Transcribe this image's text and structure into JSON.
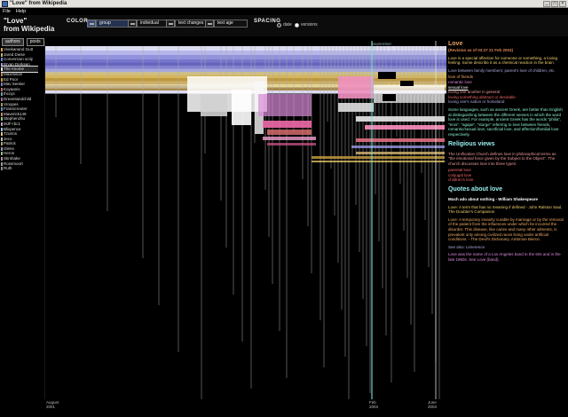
{
  "window": {
    "title": "\"Love\" from Wikipedia"
  },
  "menu": [
    "File",
    "Help"
  ],
  "document": {
    "title": "\"Love\"",
    "subtitle": "from Wikipedia"
  },
  "color": {
    "label": "COLOR",
    "options": [
      {
        "label": "group",
        "selected": true
      },
      {
        "label": "individual",
        "selected": false
      },
      {
        "label": "text changes",
        "selected": false
      },
      {
        "label": "text age",
        "selected": false
      }
    ]
  },
  "spacing": {
    "label": "SPACING",
    "options": [
      {
        "label": "date",
        "selected": true
      },
      {
        "label": "versions",
        "selected": false
      }
    ]
  },
  "tabs": [
    {
      "label": "authors",
      "selected": true
    },
    {
      "label": "posts",
      "selected": false
    }
  ],
  "authors": [
    {
      "name": "Vivekanand Gutta",
      "count": "",
      "color": "#d8a850"
    },
    {
      "name": "Jared Diese",
      "count": "",
      "color": "#c0b070"
    },
    {
      "name": "Conversion script",
      "count": "",
      "color": "#6a8cd0"
    },
    {
      "name": "Bryan Derksen",
      "count": "",
      "color": "#9999cc"
    },
    {
      "name": "The Anome",
      "count": "",
      "color": "#e0e0e0",
      "selected": true
    },
    {
      "name": "Maximilian",
      "count": "",
      "color": "#b08060"
    },
    {
      "name": "Ed Poor",
      "count": "",
      "color": "#d0a030"
    },
    {
      "name": "Mav Seeker",
      "count": "",
      "color": "#8080c0"
    },
    {
      "name": "Koyaanis",
      "count": "",
      "color": "#c07070"
    },
    {
      "name": "Ihcoyc",
      "count": "",
      "color": "#70a0a0"
    },
    {
      "name": "Dreamlandchild",
      "count": "",
      "color": "#a070a0"
    },
    {
      "name": "Vroopes",
      "count": "",
      "color": "#a0a070"
    },
    {
      "name": "Fransicreuter",
      "count": "",
      "color": "#7090c0"
    },
    {
      "name": "Maverick149",
      "count": "",
      "color": "#c09060"
    },
    {
      "name": "Stephenzhu",
      "count": "",
      "color": "#90c090"
    },
    {
      "name": "MJF-rbc1",
      "count": "",
      "color": "#c0a0c0"
    },
    {
      "name": "Blixpence",
      "count": "",
      "color": "#a0c0e0"
    },
    {
      "name": "Tzutros",
      "count": "",
      "color": "#e0c090"
    },
    {
      "name": "Jeco",
      "count": "",
      "color": "#c0c0c0"
    },
    {
      "name": "Patrick",
      "count": "",
      "color": "#b0a080"
    },
    {
      "name": "Glenn",
      "count": "",
      "color": "#90a0b0"
    },
    {
      "name": "Heron",
      "count": "",
      "color": "#a0b090"
    },
    {
      "name": "Skrshake",
      "count": "",
      "color": "#b090a0"
    },
    {
      "name": "Rossmoort",
      "count": "",
      "color": "#a0a0a0"
    },
    {
      "name": "Ruth",
      "count": "",
      "color": "#8090a0"
    }
  ],
  "viz": {
    "revision_label": "September"
  },
  "timeline": [
    {
      "label": "August",
      "sub": "2001"
    },
    {
      "label": "Feb",
      "sub": "2003"
    },
    {
      "label": "June",
      "sub": "2003"
    }
  ],
  "article": {
    "heading": "Love",
    "revision": "(Revision as of 03:27 21 Feb 2003)",
    "p1": "Love is a special affection for someone or something, a loving feeling. Some describe it as a chemical reaction in the brain.",
    "p2": "Love between family members; parent's love of children, etc.",
    "list": [
      "love of friends",
      "romantic love",
      "sexual love",
      "loving one another in general",
      "loving something abstract or desirable",
      "loving one's nation or homeland"
    ],
    "p3": "Some languages, such as ancient Greek, are better than English at distinguishing between the different senses in which the word love is used. For example, ancient Greek has the words \"philia\", \"eros\", \"agape\", \"storge\" referring to love between friends, romantic/sexual love, sacrificial love, and affection/familial love respectively.",
    "sec1": "Religious views",
    "p4": "The Unification Church defines love in philosophical terms as \"the emotional force given by the Subject to the Object\". The church discusses love into three types:",
    "types": [
      "parental love",
      "conjugal love",
      "children's love"
    ],
    "sec2": "Quotes about love",
    "quote1": "Much ado about nothing - William Shakespeare",
    "quote2": "Love: A term that has no meaning if defined - John Ralston Saul, The Doubter's Companion",
    "quote3": "Love: A temporary insanity curable by marriage or by the removal of the patient from the influences under which he incurred the disorder. This disease, like caries and many other ailments, is prevalent only among civilized races living under artificial conditions. - The Devil's Dictionary, Ambrose Bierce.",
    "see_also": "See also: Limerence",
    "p5": "Love was the name of a Los Angeles band in the 60s and in the late 1960s. See Love (band)."
  }
}
